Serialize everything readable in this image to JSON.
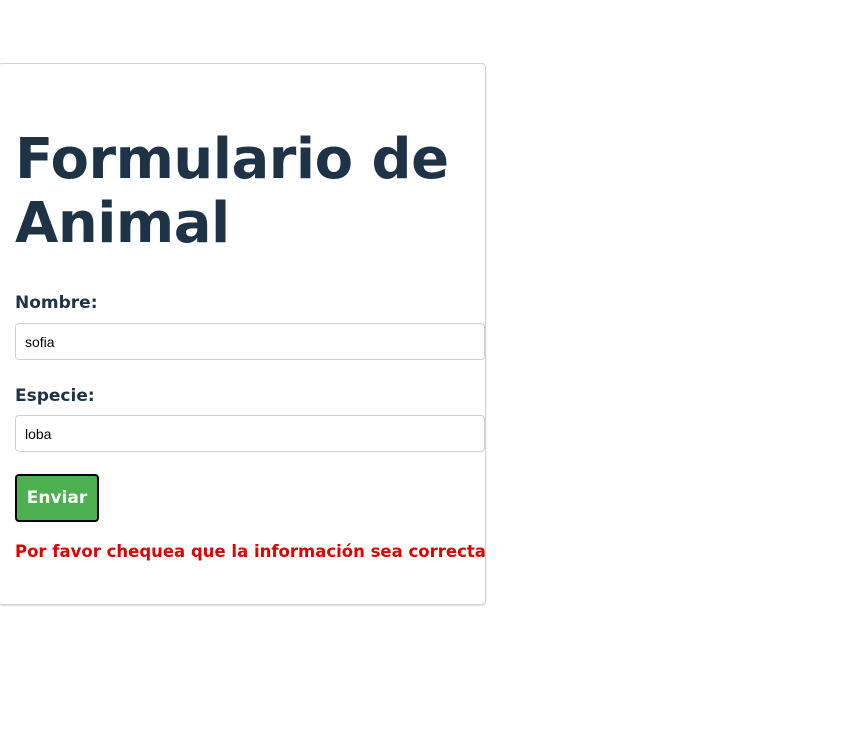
{
  "form": {
    "title": "Formulario de Animal",
    "nombre_label": "Nombre:",
    "nombre_value": "sofia",
    "especie_label": "Especie:",
    "especie_value": "loba",
    "submit_label": "Enviar",
    "message": "Por favor chequea que la información sea correcta"
  },
  "colors": {
    "title": "#1f3346",
    "button_bg": "#4caf50",
    "message": "#dd0000"
  }
}
